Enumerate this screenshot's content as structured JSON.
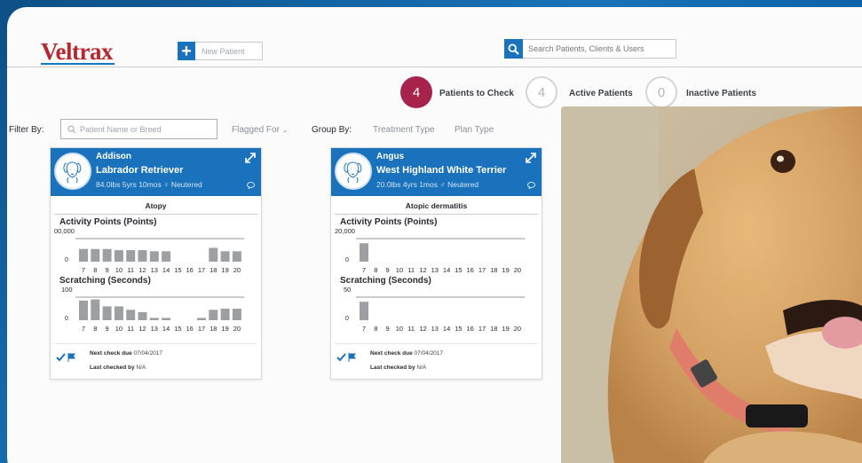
{
  "app": {
    "logo": "Veltrax"
  },
  "toolbar": {
    "new_patient_label": "New Patient",
    "search_placeholder": "Search Patients, Clients & Users"
  },
  "counts": [
    {
      "value": "4",
      "label": "Patients to Check"
    },
    {
      "value": "4",
      "label": "Active Patients"
    },
    {
      "value": "0",
      "label": "Inactive Patients"
    }
  ],
  "filters": {
    "filter_by_label": "Filter By:",
    "search_placeholder": "Patient Name or Breed",
    "flagged_for_label": "Flagged For",
    "group_by_label": "Group By:",
    "treatment_type_label": "Treatment Type",
    "plan_type_label": "Plan Type"
  },
  "cards": [
    {
      "name": "Addison",
      "breed": "Labrador Retriever",
      "info": "84.0lbs 5yrs 10mos ♀ Neutered",
      "diagnosis": "Atopy",
      "activity_title": "Activity Points (Points)",
      "activity_max": "00,000",
      "scratching_title": "Scratching (Seconds)",
      "scratching_max": "100",
      "zero_label": "0",
      "days": [
        "7",
        "8",
        "9",
        "10",
        "11",
        "12",
        "13",
        "14",
        "15",
        "16",
        "17",
        "18",
        "19",
        "20"
      ],
      "next_check_label": "Next check due",
      "next_check_value": "07/04/2017",
      "last_checked_label": "Last checked by",
      "last_checked_value": "N/A"
    },
    {
      "name": "Angus",
      "breed": "West Highland White Terrier",
      "info": "20.0lbs 4yrs 1mos ♂ Neutered",
      "diagnosis": "Atopic dermatitis",
      "activity_title": "Activity Points (Points)",
      "activity_max": "20,000",
      "scratching_title": "Scratching (Seconds)",
      "scratching_max": "50",
      "zero_label": "0",
      "days": [
        "7",
        "8",
        "9",
        "10",
        "11",
        "12",
        "13",
        "14",
        "15",
        "16",
        "17",
        "18",
        "19",
        "20"
      ],
      "next_check_label": "Next check due",
      "next_check_value": "07/04/2017",
      "last_checked_label": "Last checked by",
      "last_checked_value": "N/A"
    }
  ],
  "chart_data": [
    {
      "type": "bar",
      "title": "Activity Points (Points)",
      "categories": [
        "7",
        "8",
        "9",
        "10",
        "11",
        "12",
        "13",
        "14",
        "15",
        "16",
        "17",
        "18",
        "19",
        "20"
      ],
      "values": [
        0.55,
        0.55,
        0.55,
        0.5,
        0.5,
        0.5,
        0.45,
        0.45,
        null,
        null,
        null,
        0.6,
        0.45,
        0.45
      ],
      "ymax_label": "00,000"
    },
    {
      "type": "bar",
      "title": "Scratching (Seconds)",
      "categories": [
        "7",
        "8",
        "9",
        "10",
        "11",
        "12",
        "13",
        "14",
        "15",
        "16",
        "17",
        "18",
        "19",
        "20"
      ],
      "values": [
        0.85,
        0.9,
        0.6,
        0.6,
        0.45,
        0.35,
        0.1,
        0.1,
        null,
        null,
        0.1,
        0.45,
        0.5,
        0.5
      ],
      "ymax_label": "100"
    },
    {
      "type": "bar",
      "title": "Activity Points (Points)",
      "categories": [
        "7",
        "8",
        "9",
        "10",
        "11",
        "12",
        "13",
        "14",
        "15",
        "16",
        "17",
        "18",
        "19",
        "20"
      ],
      "values": [
        0.8,
        null,
        null,
        null,
        null,
        null,
        null,
        null,
        null,
        null,
        null,
        null,
        null,
        null
      ],
      "ymax_label": "20,000"
    },
    {
      "type": "bar",
      "title": "Scratching (Seconds)",
      "categories": [
        "7",
        "8",
        "9",
        "10",
        "11",
        "12",
        "13",
        "14",
        "15",
        "16",
        "17",
        "18",
        "19",
        "20"
      ],
      "values": [
        0.8,
        null,
        null,
        null,
        null,
        null,
        null,
        null,
        null,
        null,
        null,
        null,
        null,
        null
      ],
      "ymax_label": "50"
    }
  ],
  "colors": {
    "brand_blue": "#1a72bd",
    "logo_red": "#b7282e",
    "badge_red": "#a8234b",
    "bar_grey": "#9d9fa3"
  }
}
